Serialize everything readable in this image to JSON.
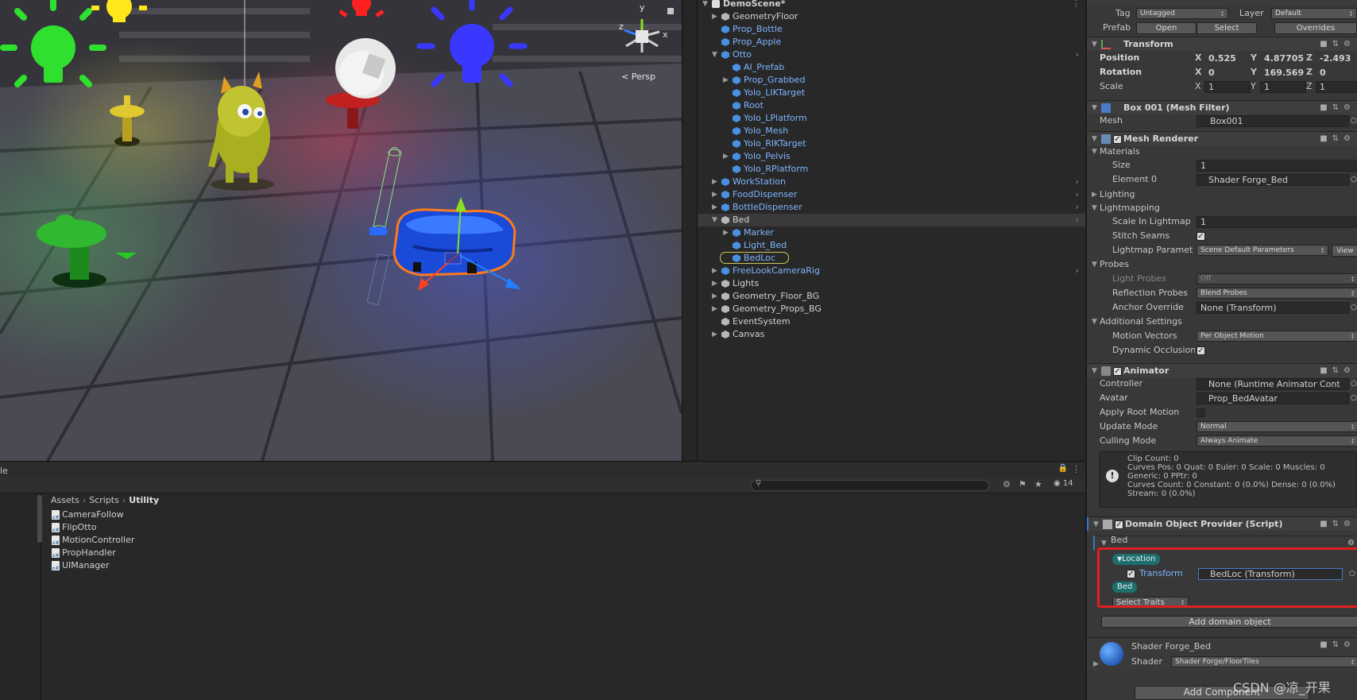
{
  "scene": {
    "camera_label": "Persp",
    "axis_labels": {
      "y": "y",
      "z": "z",
      "x": "x"
    }
  },
  "hierarchy": {
    "scene_name": "DemoScene*",
    "items": [
      {
        "label": "GeometryFloor",
        "depth": 1,
        "expand": "collapsed",
        "prefab": false
      },
      {
        "label": "Prop_Bottle",
        "depth": 1,
        "expand": "none",
        "prefab": true
      },
      {
        "label": "Prop_Apple",
        "depth": 1,
        "expand": "none",
        "prefab": true
      },
      {
        "label": "Otto",
        "depth": 1,
        "expand": "expanded",
        "prefab": true,
        "more": true
      },
      {
        "label": "AI_Prefab",
        "depth": 2,
        "expand": "none",
        "prefab": true
      },
      {
        "label": "Prop_Grabbed",
        "depth": 2,
        "expand": "collapsed",
        "prefab": true
      },
      {
        "label": "Yolo_LIKTarget",
        "depth": 2,
        "expand": "none",
        "prefab": true
      },
      {
        "label": "Root",
        "depth": 2,
        "expand": "none",
        "prefab": true
      },
      {
        "label": "Yolo_LPlatform",
        "depth": 2,
        "expand": "none",
        "prefab": true
      },
      {
        "label": "Yolo_Mesh",
        "depth": 2,
        "expand": "none",
        "prefab": true
      },
      {
        "label": "Yolo_RIKTarget",
        "depth": 2,
        "expand": "none",
        "prefab": true
      },
      {
        "label": "Yolo_Pelvis",
        "depth": 2,
        "expand": "collapsed",
        "prefab": true
      },
      {
        "label": "Yolo_RPlatform",
        "depth": 2,
        "expand": "none",
        "prefab": true
      },
      {
        "label": "WorkStation",
        "depth": 1,
        "expand": "collapsed",
        "prefab": true,
        "more": true
      },
      {
        "label": "FoodDispenser",
        "depth": 1,
        "expand": "collapsed",
        "prefab": true,
        "more": true
      },
      {
        "label": "BottleDispenser",
        "depth": 1,
        "expand": "collapsed",
        "prefab": true,
        "more": true
      },
      {
        "label": "Bed",
        "depth": 1,
        "expand": "expanded",
        "prefab": false,
        "more": true,
        "selected": true
      },
      {
        "label": "Marker",
        "depth": 2,
        "expand": "collapsed",
        "prefab": true
      },
      {
        "label": "Light_Bed",
        "depth": 2,
        "expand": "none",
        "prefab": true
      },
      {
        "label": "BedLoc",
        "depth": 2,
        "expand": "none",
        "prefab": true,
        "highlight": true
      },
      {
        "label": "FreeLookCameraRig",
        "depth": 1,
        "expand": "collapsed",
        "prefab": true,
        "more": true
      },
      {
        "label": "Lights",
        "depth": 1,
        "expand": "collapsed",
        "prefab": false
      },
      {
        "label": "Geometry_Floor_BG",
        "depth": 1,
        "expand": "collapsed",
        "prefab": false
      },
      {
        "label": "Geometry_Props_BG",
        "depth": 1,
        "expand": "collapsed",
        "prefab": false
      },
      {
        "label": "EventSystem",
        "depth": 1,
        "expand": "none",
        "prefab": false
      },
      {
        "label": "Canvas",
        "depth": 1,
        "expand": "collapsed",
        "prefab": false
      }
    ]
  },
  "inspector": {
    "tag_label": "Tag",
    "tag_value": "Untagged",
    "layer_label": "Layer",
    "layer_value": "Default",
    "prefab_label": "Prefab",
    "open": "Open",
    "select": "Select",
    "overrides": "Overrides",
    "transform": {
      "title": "Transform",
      "position_label": "Position",
      "position": {
        "x": "0.525",
        "y": "4.87705",
        "z": "-2.493"
      },
      "rotation_label": "Rotation",
      "rotation": {
        "x": "0",
        "y": "169.569",
        "z": "0"
      },
      "scale_label": "Scale",
      "scale": {
        "x": "1",
        "y": "1",
        "z": "1"
      },
      "x": "X",
      "y": "Y",
      "z": "Z"
    },
    "mesh_filter": {
      "title": "Box 001 (Mesh Filter)",
      "mesh_label": "Mesh",
      "mesh_value": "Box001"
    },
    "mesh_renderer": {
      "title": "Mesh Renderer",
      "materials": "Materials",
      "size_label": "Size",
      "size_value": "1",
      "element0_label": "Element 0",
      "element0_value": "Shader Forge_Bed",
      "lighting": "Lighting",
      "lightmapping": "Lightmapping",
      "scale_lightmap_label": "Scale In Lightmap",
      "scale_lightmap_value": "1",
      "stitch_label": "Stitch Seams",
      "lm_params_label": "Lightmap Paramet",
      "lm_params_value": "Scene Default Parameters",
      "view": "View",
      "probes": "Probes",
      "light_probes_label": "Light Probes",
      "light_probes_value": "Off",
      "refl_probes_label": "Reflection Probes",
      "refl_probes_value": "Blend Probes",
      "anchor_label": "Anchor Override",
      "anchor_value": "None (Transform)",
      "additional": "Additional Settings",
      "motion_label": "Motion Vectors",
      "motion_value": "Per Object Motion",
      "dyn_occl_label": "Dynamic Occlusion"
    },
    "animator": {
      "title": "Animator",
      "controller_label": "Controller",
      "controller_value": "None (Runtime Animator Cont",
      "avatar_label": "Avatar",
      "avatar_value": "Prop_BedAvatar",
      "root_motion_label": "Apply Root Motion",
      "update_label": "Update Mode",
      "update_value": "Normal",
      "culling_label": "Culling Mode",
      "culling_value": "Always Animate",
      "info": [
        "Clip Count: 0",
        "Curves Pos: 0 Quat: 0 Euler: 0 Scale: 0 Muscles: 0",
        "Generic: 0 PPtr: 0",
        "Curves Count: 0 Constant: 0 (0.0%) Dense: 0 (0.0%)",
        "Stream: 0 (0.0%)"
      ]
    },
    "domain": {
      "title": "Domain Object Provider (Script)",
      "object_name": "Bed",
      "trait_location": "Location",
      "transform_label": "Transform",
      "transform_value": "BedLoc (Transform)",
      "trait_bed": "Bed",
      "select_traits": "Select Traits",
      "add_domain": "Add domain object"
    },
    "material": {
      "title": "Shader Forge_Bed",
      "shader_label": "Shader",
      "shader_value": "Shader Forge/FloorTiles"
    },
    "add_component": "Add Component"
  },
  "project": {
    "tab_fragment": "le",
    "hidden_count": "14",
    "breadcrumbs": [
      "Assets",
      "Scripts",
      "Utility"
    ],
    "files": [
      "CameraFollow",
      "FlipOtto",
      "MotionController",
      "PropHandler",
      "UIManager"
    ]
  },
  "watermark": "CSDN @凉_开果",
  "colors": {
    "selection_outline": "#ff7a1a",
    "prefab_text": "#7fb4ff",
    "highlight_box": "#e02020",
    "trait_pill": "#1f6e6e"
  }
}
